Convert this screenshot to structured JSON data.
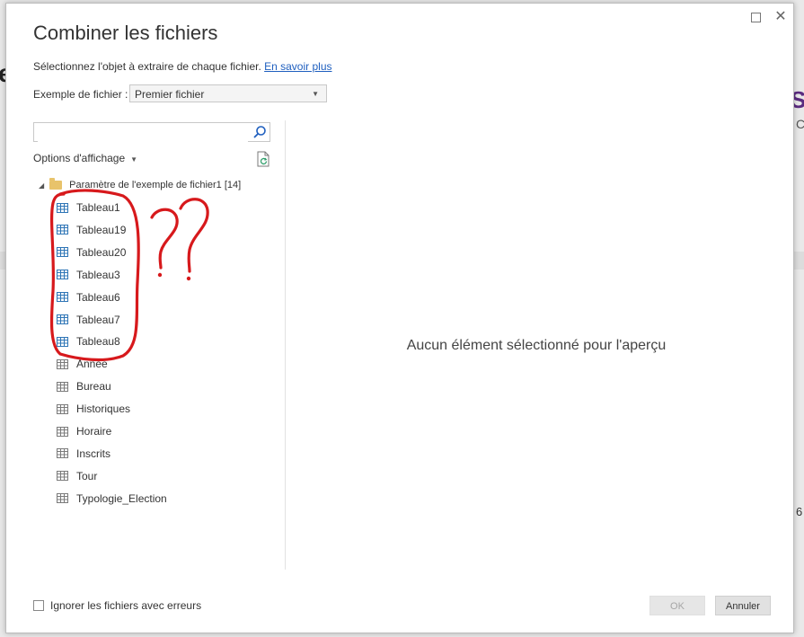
{
  "background": {
    "left_fragment": "e",
    "right_fragment": "S",
    "right_small": "C",
    "right_number": "6"
  },
  "dialog": {
    "title": "Combiner les fichiers",
    "subtitle": "Sélectionnez l'objet à extraire de chaque fichier.",
    "learn_more": "En savoir plus",
    "example_label": "Exemple de fichier :",
    "example_value": "Premier fichier",
    "search_placeholder": "",
    "options_label": "Options d'affichage",
    "tree": {
      "root_label": "Paramètre de l'exemple de fichier1 [14]",
      "items": [
        {
          "label": "Tableau1",
          "type": "table"
        },
        {
          "label": "Tableau19",
          "type": "table"
        },
        {
          "label": "Tableau20",
          "type": "table"
        },
        {
          "label": "Tableau3",
          "type": "table"
        },
        {
          "label": "Tableau6",
          "type": "table"
        },
        {
          "label": "Tableau7",
          "type": "table"
        },
        {
          "label": "Tableau8",
          "type": "table"
        },
        {
          "label": "Annee",
          "type": "sheet"
        },
        {
          "label": "Bureau",
          "type": "sheet"
        },
        {
          "label": "Historiques",
          "type": "sheet"
        },
        {
          "label": "Horaire",
          "type": "sheet"
        },
        {
          "label": "Inscrits",
          "type": "sheet"
        },
        {
          "label": "Tour",
          "type": "sheet"
        },
        {
          "label": "Typologie_Election",
          "type": "sheet"
        }
      ]
    },
    "preview_empty": "Aucun élément sélectionné pour l'aperçu",
    "ignore_errors_label": "Ignorer les fichiers avec erreurs",
    "ok_label": "OK",
    "cancel_label": "Annuler",
    "annotation": "??"
  },
  "colors": {
    "link": "#1f5fbf",
    "annotation": "#d7191c",
    "table_icon": "#2e75b6"
  }
}
